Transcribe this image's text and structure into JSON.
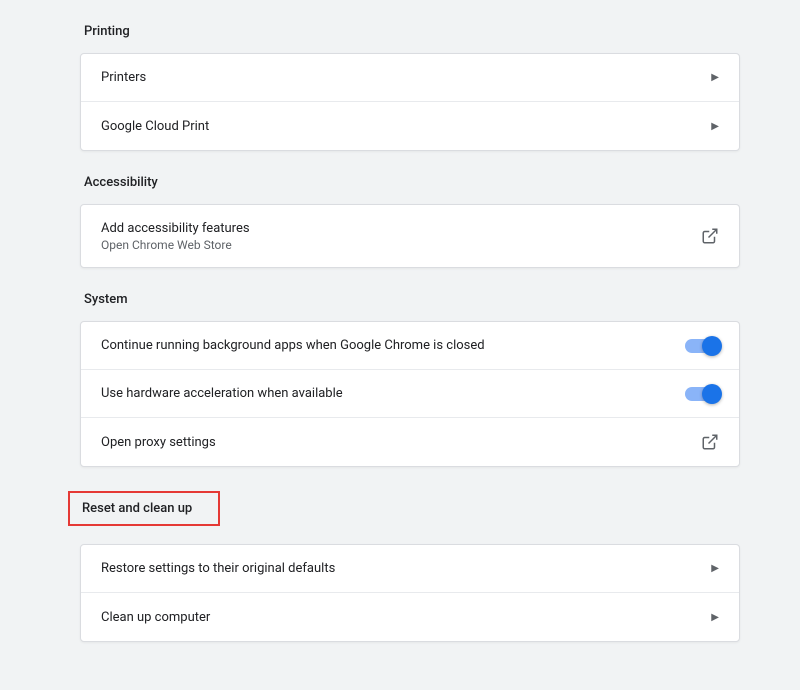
{
  "sections": {
    "printing": {
      "title": "Printing",
      "items": [
        {
          "label": "Printers"
        },
        {
          "label": "Google Cloud Print"
        }
      ]
    },
    "accessibility": {
      "title": "Accessibility",
      "item": {
        "label": "Add accessibility features",
        "sublabel": "Open Chrome Web Store"
      }
    },
    "system": {
      "title": "System",
      "items": [
        {
          "label": "Continue running background apps when Google Chrome is closed"
        },
        {
          "label": "Use hardware acceleration when available"
        },
        {
          "label": "Open proxy settings"
        }
      ]
    },
    "reset": {
      "title": "Reset and clean up",
      "items": [
        {
          "label": "Restore settings to their original defaults"
        },
        {
          "label": "Clean up computer"
        }
      ]
    }
  }
}
